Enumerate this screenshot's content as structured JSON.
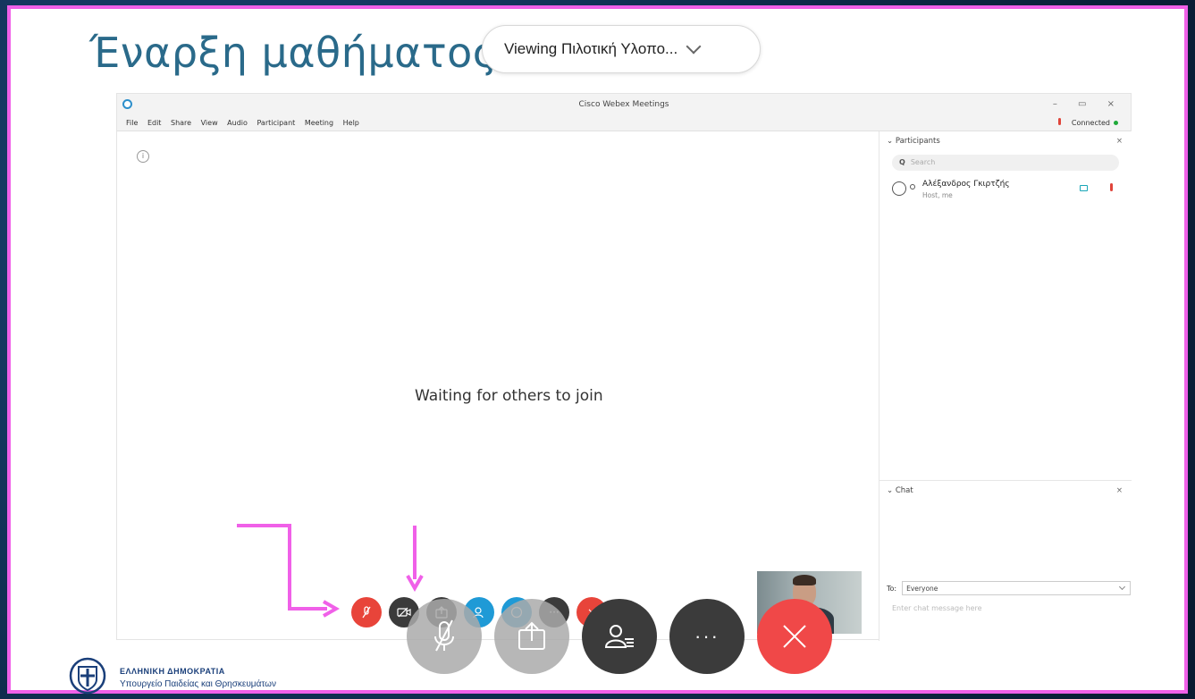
{
  "slide": {
    "title": "Έναρξη μαθήματος",
    "viewing_label": "Viewing Πιλοτική Υλοπο..."
  },
  "webex": {
    "window_title": "Cisco Webex Meetings",
    "window_buttons": "– ▭ ×",
    "menu": [
      "File",
      "Edit",
      "Share",
      "View",
      "Audio",
      "Participant",
      "Meeting",
      "Help"
    ],
    "connection_status": "Connected",
    "waiting_text": "Waiting for others to join",
    "participants_header": "Participants",
    "search_placeholder": "Search",
    "participant": {
      "name": "Αλέξανδρος Γκιρτζής",
      "role": "Host, me"
    },
    "chat_header": "Chat",
    "chat_to_label": "To:",
    "chat_to_value": "Everyone",
    "chat_input_placeholder": "Enter chat message here",
    "toolbar_colors": [
      "#e8443a",
      "#3b3b3b",
      "#3b3b3b",
      "#1f9ad6",
      "#1f9ad6",
      "#3b3b3b",
      "#e8443a"
    ],
    "toolbar_icons": [
      "mic-muted-icon",
      "video-off-icon",
      "share-icon",
      "participants-icon",
      "chat-icon",
      "more-icon",
      "leave-icon"
    ]
  },
  "overlay_controls": {
    "more_label": "···",
    "icons": [
      "mic-muted-icon",
      "share-icon",
      "participants-icon",
      "more-icon",
      "close-icon"
    ]
  },
  "footer": {
    "gov_line1": "ΕΛΛΗΝΙΚΗ ΔΗΜΟΚΡΑΤΙΑ",
    "gov_line2": "Υπουργείο Παιδείας και Θρησκευμάτων"
  },
  "colors": {
    "accent_border": "#f060e8",
    "title_color": "#2a6a8a",
    "end_red": "#f04848"
  }
}
